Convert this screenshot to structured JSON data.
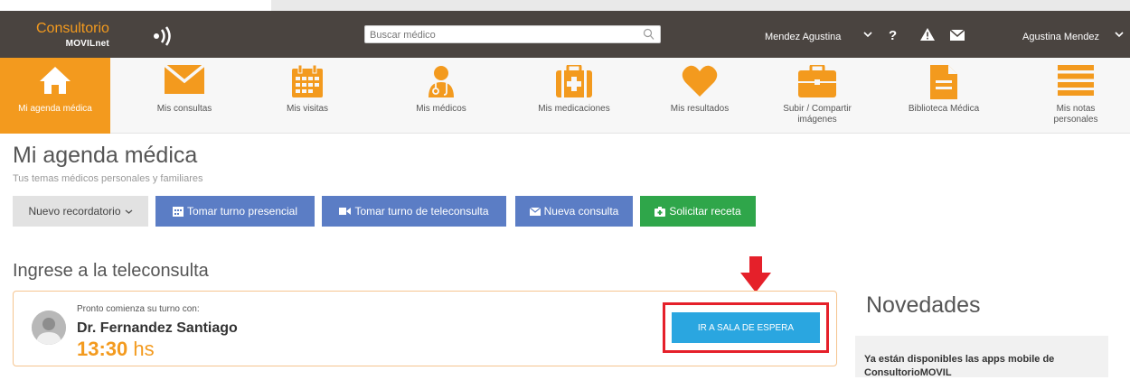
{
  "header": {
    "logo_main": "Consultorio",
    "logo_sub": "MOVILnet",
    "search_placeholder": "Buscar médico",
    "patient_name": "Mendez Agustina",
    "user_name": "Agustina Mendez",
    "help_symbol": "?",
    "alert_symbol": "!"
  },
  "nav": {
    "items": [
      {
        "label": "Mi agenda médica",
        "icon": "home-icon",
        "active": true
      },
      {
        "label": "Mis consultas",
        "icon": "envelope-icon"
      },
      {
        "label": "Mis visitas",
        "icon": "calendar-icon"
      },
      {
        "label": "Mis médicos",
        "icon": "doctor-icon"
      },
      {
        "label": "Mis medicaciones",
        "icon": "medkit-icon"
      },
      {
        "label": "Mis resultados",
        "icon": "heart-icon"
      },
      {
        "label": "Subir / Compartir imágenes",
        "icon": "briefcase-icon"
      },
      {
        "label": "Biblioteca Médica",
        "icon": "document-icon"
      },
      {
        "label": "Mis notas personales",
        "icon": "list-icon"
      }
    ]
  },
  "page": {
    "title": "Mi agenda médica",
    "subtitle": "Tus temas médicos personales y familiares"
  },
  "actions": {
    "reminder": "Nuevo recordatorio",
    "in_person": "Tomar turno presencial",
    "teleconsult": "Tomar turno de teleconsulta",
    "new_query": "Nueva consulta",
    "prescription": "Solicitar receta"
  },
  "teleconsulta": {
    "title": "Ingrese a la teleconsulta",
    "soon": "Pronto comienza su turno con:",
    "doctor": "Dr. Fernandez Santiago",
    "time": "13:30",
    "time_unit": "hs",
    "wait_button": "IR A SALA DE ESPERA"
  },
  "novedades": {
    "title": "Novedades",
    "text": "Ya están disponibles las apps mobile de ConsultorioMOVIL"
  },
  "colors": {
    "header_bg": "#4a4440",
    "accent_orange": "#f39a1e",
    "button_blue": "#5b7dc5",
    "button_green": "#2fa64a",
    "wait_button": "#2aa6e0",
    "highlight_red": "#e5202a"
  }
}
